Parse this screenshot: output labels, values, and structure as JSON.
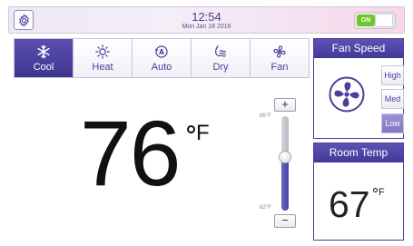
{
  "status": {
    "time": "12:54",
    "date": "Mon Jan 18 2016",
    "power_label": "ON",
    "power_on": true
  },
  "modes": [
    {
      "label": "Cool",
      "icon": "snowflake-icon",
      "active": true
    },
    {
      "label": "Heat",
      "icon": "sun-icon",
      "active": false
    },
    {
      "label": "Auto",
      "icon": "auto-icon",
      "active": false
    },
    {
      "label": "Dry",
      "icon": "dry-icon",
      "active": false
    },
    {
      "label": "Fan",
      "icon": "fan-icon",
      "active": false
    }
  ],
  "setpoint": {
    "value": "76",
    "unit": "F",
    "max_label": "86°F",
    "min_label": "62°F",
    "slider_level": 0.57
  },
  "fan_speed": {
    "title": "Fan Speed",
    "options": [
      "High",
      "Med",
      "Low"
    ],
    "selected": "Low"
  },
  "room": {
    "title": "Room Temp",
    "value": "67",
    "unit": "F"
  },
  "colors": {
    "accent": "#4a3f9a",
    "active_mode": "#4a41a3",
    "power_on": "#6fc62a"
  }
}
